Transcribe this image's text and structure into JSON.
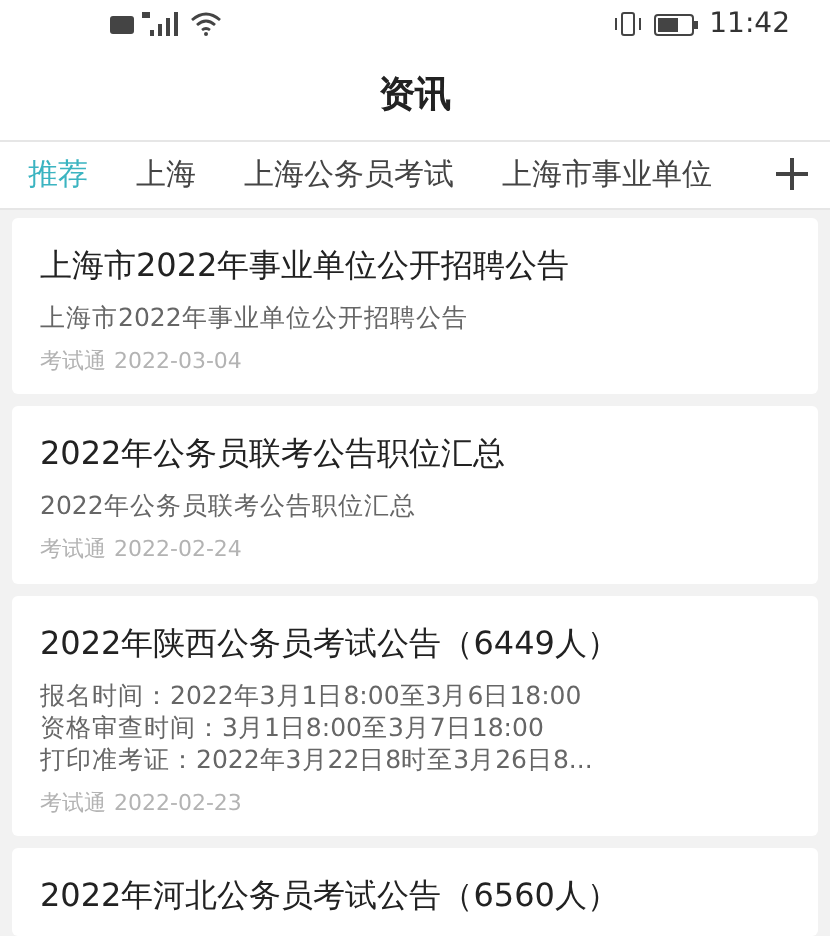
{
  "status_bar": {
    "time": "11:42"
  },
  "header": {
    "title": "资讯"
  },
  "tabs": [
    {
      "label": "推荐",
      "selected": true
    },
    {
      "label": "上海",
      "selected": false
    },
    {
      "label": "上海公务员考试",
      "selected": false
    },
    {
      "label": "上海市事业单位",
      "selected": false
    }
  ],
  "articles": [
    {
      "title": "上海市2022年事业单位公开招聘公告",
      "summary": [
        "上海市2022年事业单位公开招聘公告"
      ],
      "source": "考试通",
      "date": "2022-03-04"
    },
    {
      "title": "2022年公务员联考公告职位汇总",
      "summary": [
        "2022年公务员联考公告职位汇总"
      ],
      "source": "考试通",
      "date": "2022-02-24"
    },
    {
      "title": "2022年陕西公务员考试公告（6449人）",
      "summary": [
        "报名时间：2022年3月1日8:00至3月6日18:00",
        "资格审查时间：3月1日8:00至3月7日18:00",
        "打印准考证：2022年3月22日8时至3月26日8..."
      ],
      "source": "考试通",
      "date": "2022-02-23"
    },
    {
      "title": "2022年河北公务员考试公告（6560人）"
    }
  ]
}
